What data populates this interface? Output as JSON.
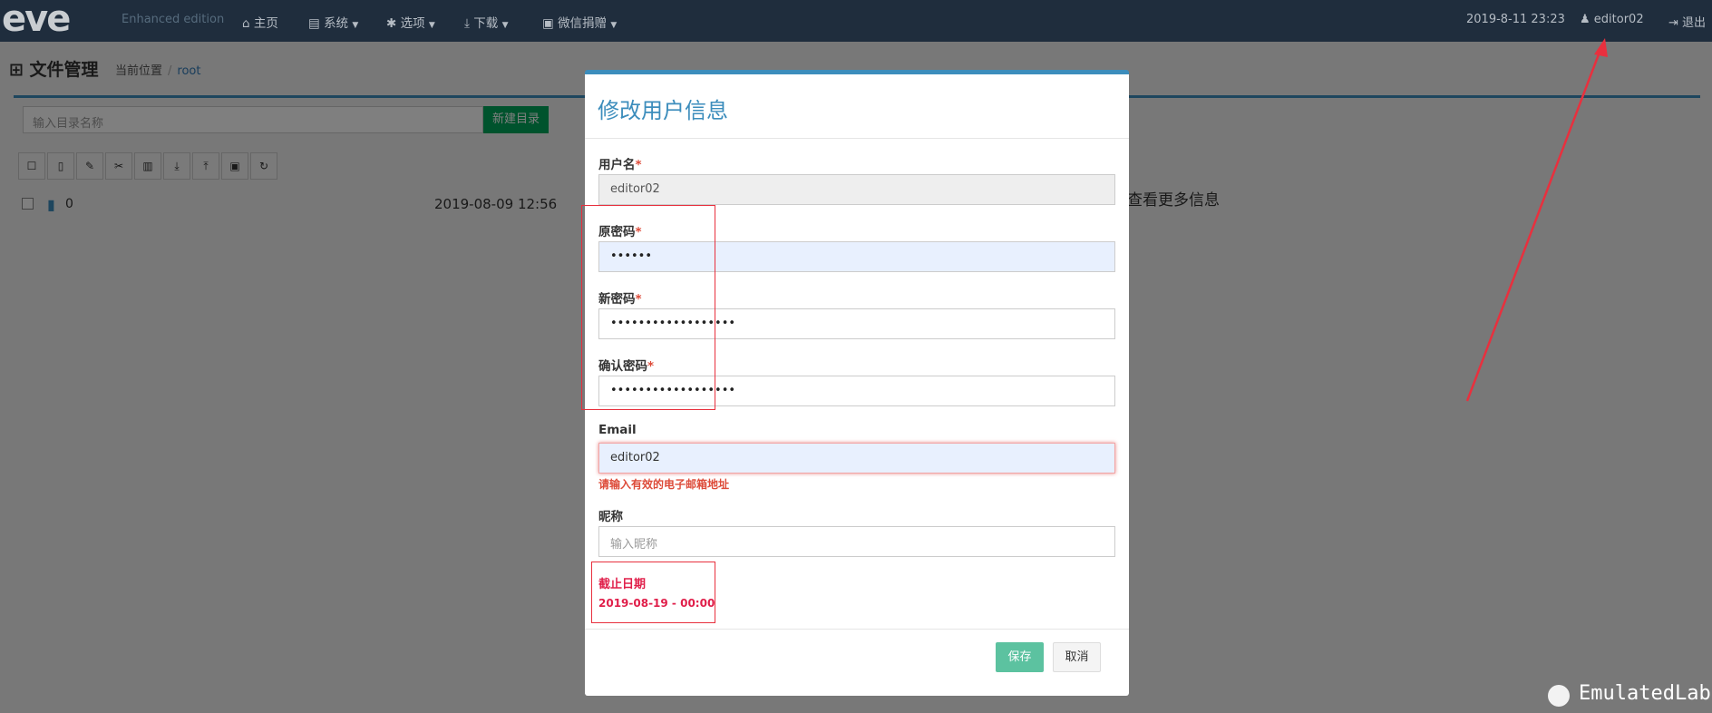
{
  "navbar": {
    "logo": "eve",
    "edition": "Enhanced edition",
    "items": [
      {
        "icon": "home-icon",
        "label": "主页",
        "caret": false
      },
      {
        "icon": "book-icon",
        "label": "系统",
        "caret": true
      },
      {
        "icon": "gear-icon",
        "label": "选项",
        "caret": true
      },
      {
        "icon": "download-icon",
        "label": "下载",
        "caret": true
      },
      {
        "icon": "image-icon",
        "label": "微信捐赠",
        "caret": true
      }
    ],
    "datetime": "2019-8-11  23:23",
    "user": "editor02",
    "logout": "退出"
  },
  "page": {
    "title": "文件管理",
    "breadcrumb_label": "当前位置",
    "breadcrumb_root": "root",
    "dir_placeholder": "输入目录名称",
    "new_dir_button": "新建目录",
    "file": {
      "name": "0",
      "date": "2019-08-09 12:56"
    },
    "right_text": "查看更多信息"
  },
  "modal": {
    "title": "修改用户信息",
    "username_label": "用户名",
    "username_value": "editor02",
    "old_password_label": "原密码",
    "old_password_value": "••••••",
    "new_password_label": "新密码",
    "new_password_value": "••••••••••••••••••",
    "confirm_password_label": "确认密码",
    "confirm_password_value": "••••••••••••••••••",
    "email_label": "Email",
    "email_value": "editor02",
    "email_error": "请输入有效的电子邮箱地址",
    "nickname_label": "昵称",
    "nickname_placeholder": "输入昵称",
    "expiry_label": "截止日期",
    "expiry_value": "2019-08-19 - 00:00",
    "required_mark": "*",
    "save_button": "保存",
    "cancel_button": "取消"
  },
  "watermark": "EmulatedLab",
  "colors": {
    "navbar": "#1f2d3d",
    "accent": "#3c8dbc",
    "annotation_red": "#e8303e",
    "save_green": "#5cc2a0"
  }
}
